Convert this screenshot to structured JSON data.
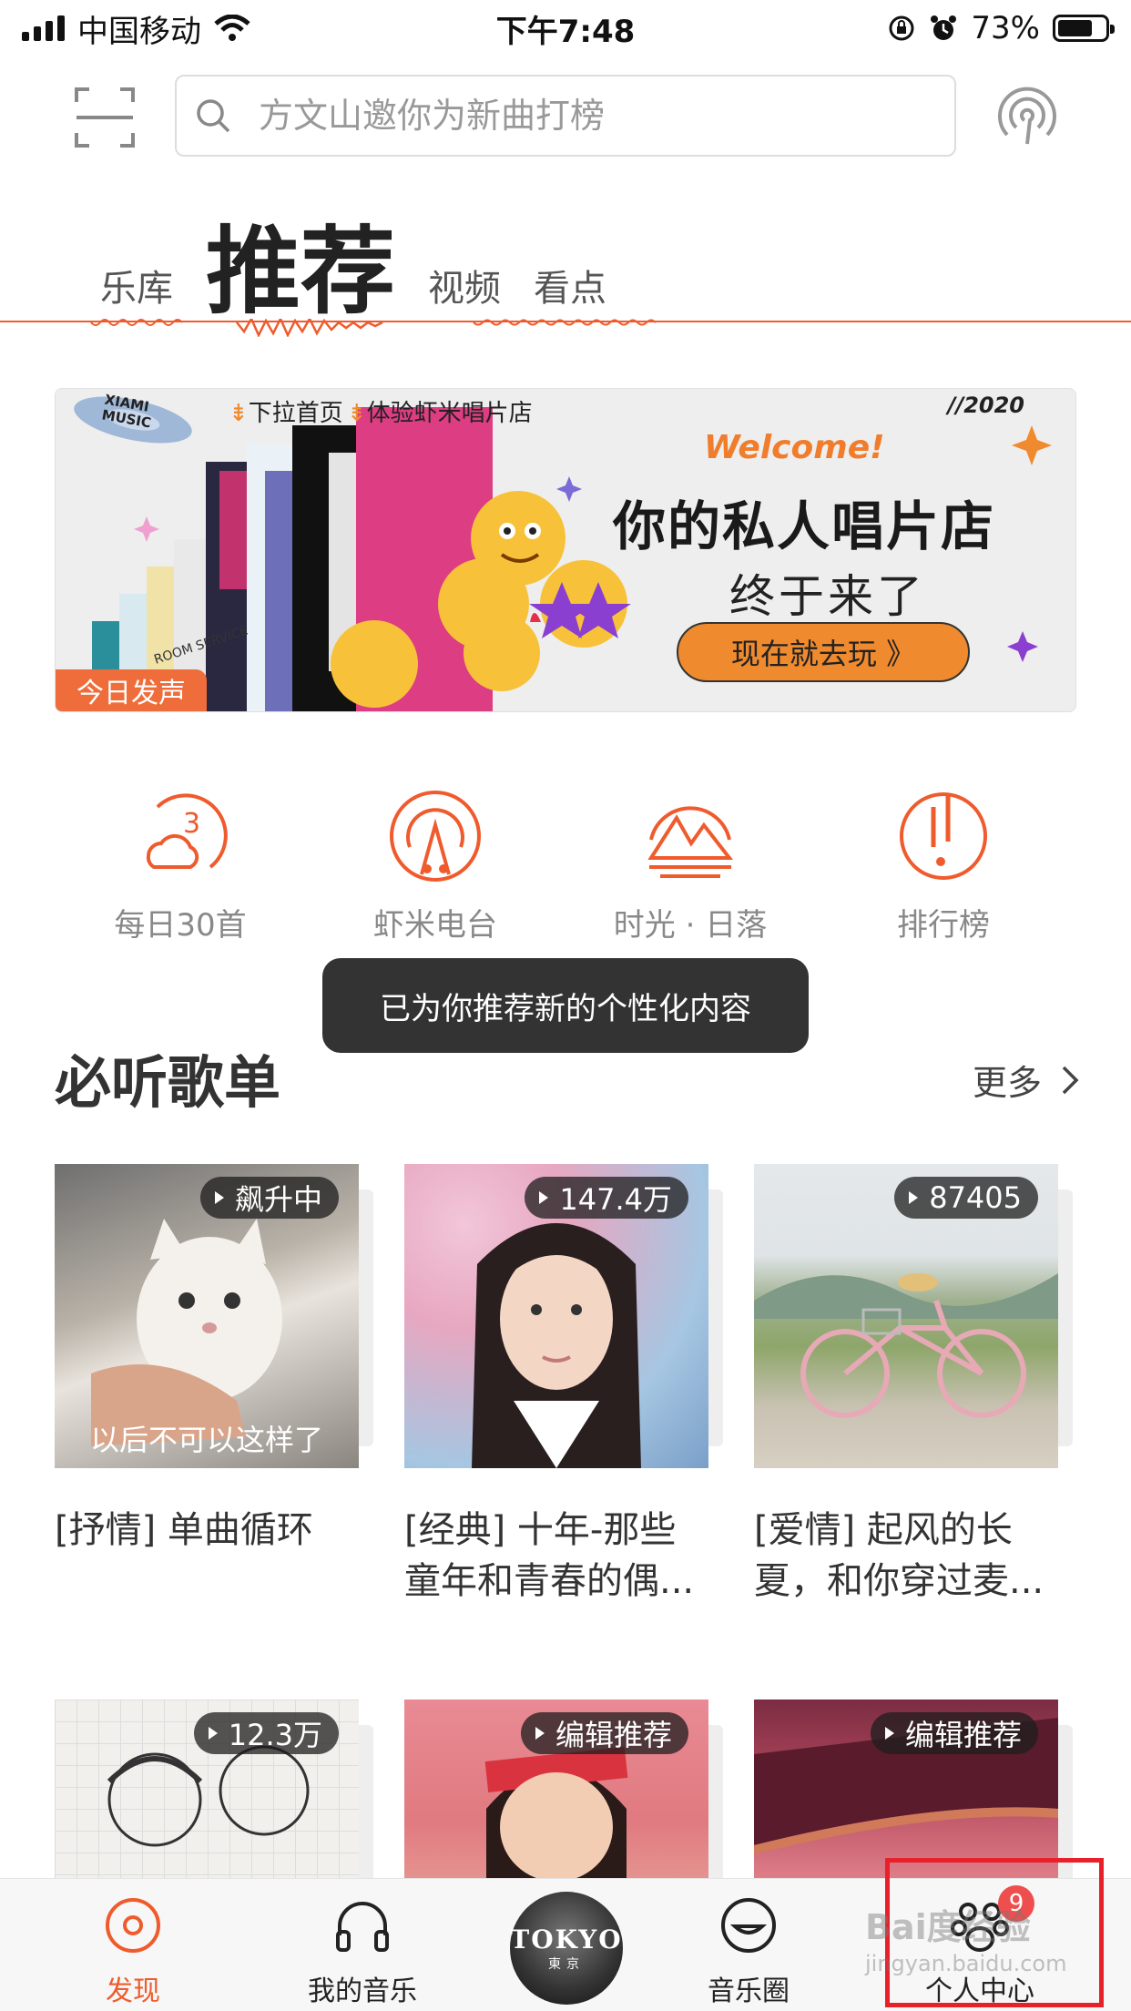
{
  "status_bar": {
    "carrier": "中国移动",
    "time": "下午7:48",
    "battery_percent": "73%",
    "battery_level": 0.73
  },
  "header": {
    "search_placeholder": "方文山邀你为新曲打榜",
    "scan_icon": "scan-icon",
    "radio_icon": "radio-signal-icon"
  },
  "tabs": [
    {
      "label": "乐库",
      "active": false
    },
    {
      "label": "推荐",
      "active": true
    },
    {
      "label": "视频",
      "active": false
    },
    {
      "label": "看点",
      "active": false
    }
  ],
  "banner": {
    "logo_line1": "XIAMI",
    "logo_line2": "MUSIC",
    "top_text": "下拉首页",
    "top_text2": "体验虾米唱片店",
    "year": "//2020",
    "welcome": "Welcome!",
    "title": "你的私人唱片店",
    "subtitle": "终于来了",
    "button": "现在就去玩 》",
    "tag": "今日发声",
    "album_text": "ROOM SERVICE"
  },
  "quick_entries": [
    {
      "label": "每日30首",
      "icon": "daily-30-icon"
    },
    {
      "label": "虾米电台",
      "icon": "radio-tower-icon"
    },
    {
      "label": "时光 · 日落",
      "icon": "sunset-mountain-icon"
    },
    {
      "label": "排行榜",
      "icon": "chart-rank-icon"
    }
  ],
  "toast": "已为你推荐新的个性化内容",
  "section": {
    "title": "必听歌单",
    "more": "更多"
  },
  "playlists": [
    {
      "count": "飙升中",
      "caption": "以后不可以这样了",
      "title": "[抒情] 单曲循环"
    },
    {
      "count": "147.4万",
      "caption": "",
      "title": "[经典] 十年-那些童年和青春的偶..."
    },
    {
      "count": "87405",
      "caption": "",
      "title": "[爱情] 起风的长夏，和你穿过麦..."
    },
    {
      "count": "12.3万",
      "caption": "",
      "title": ""
    },
    {
      "count": "编辑推荐",
      "caption": "",
      "title": ""
    },
    {
      "count": "编辑推荐",
      "caption": "",
      "title": ""
    }
  ],
  "bottom_nav": [
    {
      "label": "发现",
      "icon": "discover-icon",
      "active": true
    },
    {
      "label": "我的音乐",
      "icon": "headphones-icon",
      "active": false
    },
    {
      "label": "音乐圈",
      "icon": "smile-icon",
      "active": false
    },
    {
      "label": "个人中心",
      "icon": "paw-icon",
      "active": false
    }
  ],
  "now_playing": {
    "line1": "TOKYO",
    "line2": "東京"
  },
  "profile_badge": "9",
  "watermark": {
    "line1": "Bai度经验",
    "line2": "jingyan.baidu.com"
  },
  "colors": {
    "accent": "#ef5b2c",
    "badge": "#ef4e4e",
    "toast_bg": "#333333",
    "banner_button": "#f08a2e"
  }
}
